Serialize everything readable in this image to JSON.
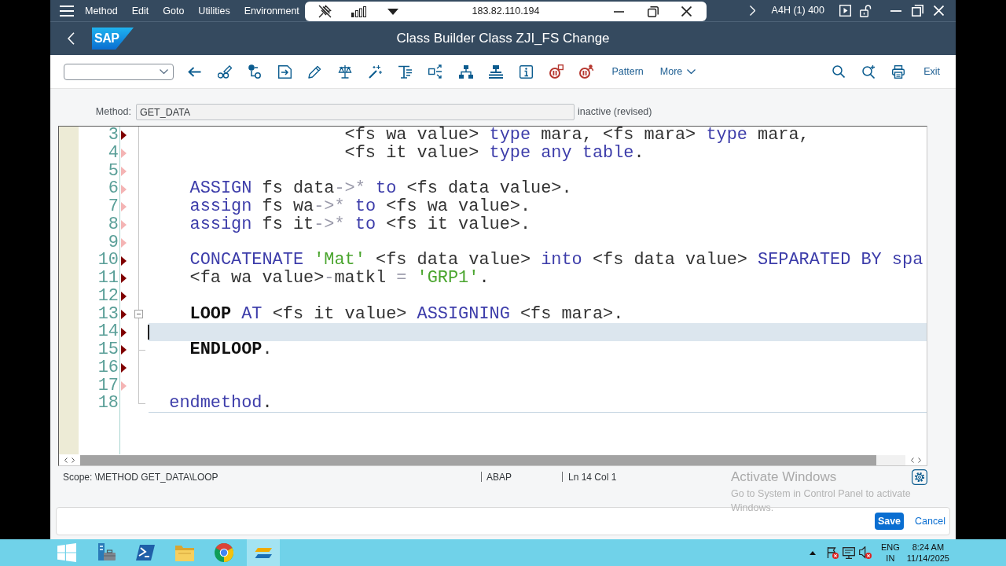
{
  "menu_bar": {
    "menus": [
      "Method",
      "Edit",
      "Goto",
      "Utilities",
      "Environment"
    ],
    "system": "A4H (1) 400"
  },
  "remote_bar": {
    "host": "183.82.110.194"
  },
  "title_bar": {
    "logo": "SAP",
    "title": "Class Builder Class ZJI_FS Change"
  },
  "toolbar": {
    "buttons": [
      {
        "label": "Pattern",
        "kind": "text"
      },
      {
        "label": "More",
        "kind": "menu"
      }
    ],
    "exit": "Exit"
  },
  "method_bar": {
    "label": "Method:",
    "value": "GET_DATA",
    "status": "inactive (revised)"
  },
  "editor": {
    "lines": [
      {
        "number": "3",
        "marker": {
          "color": "#800000"
        },
        "current": false,
        "tokens": [
          {
            "kind": "plain",
            "text": "                   <fs wa value> "
          },
          {
            "kind": "keyword",
            "text": "type"
          },
          {
            "kind": "plain",
            "text": " mara, <fs mara> "
          },
          {
            "kind": "keyword",
            "text": "type"
          },
          {
            "kind": "plain",
            "text": " mara,"
          }
        ]
      },
      {
        "number": "4",
        "marker": {
          "color": "#f4b4b4"
        },
        "current": false,
        "tokens": [
          {
            "kind": "plain",
            "text": "                   <fs it value> "
          },
          {
            "kind": "keyword",
            "text": "type any table"
          },
          {
            "kind": "plain",
            "text": "."
          }
        ]
      },
      {
        "number": "5",
        "marker": {
          "color": "#f4b4b4"
        },
        "current": false
      },
      {
        "number": "6",
        "marker": {
          "color": "#f4b4b4"
        },
        "current": false,
        "tokens": [
          {
            "kind": "keyword",
            "text": "    ASSIGN"
          },
          {
            "kind": "plain",
            "text": " fs data"
          },
          {
            "kind": "operator",
            "text": "->*"
          },
          {
            "kind": "keyword",
            "text": " to"
          },
          {
            "kind": "plain",
            "text": " <fs data value>."
          }
        ]
      },
      {
        "number": "7",
        "marker": {
          "color": "#f4b4b4"
        },
        "current": false,
        "tokens": [
          {
            "kind": "keyword",
            "text": "    assign"
          },
          {
            "kind": "plain",
            "text": " fs wa"
          },
          {
            "kind": "operator",
            "text": "->*"
          },
          {
            "kind": "keyword",
            "text": " to"
          },
          {
            "kind": "plain",
            "text": " <fs wa value>."
          }
        ]
      },
      {
        "number": "8",
        "marker": {
          "color": "#f4b4b4"
        },
        "current": false,
        "tokens": [
          {
            "kind": "keyword",
            "text": "    assign"
          },
          {
            "kind": "plain",
            "text": " fs it"
          },
          {
            "kind": "operator",
            "text": "->*"
          },
          {
            "kind": "keyword",
            "text": " to"
          },
          {
            "kind": "plain",
            "text": " <fs it value>."
          }
        ]
      },
      {
        "number": "9",
        "marker": {
          "color": "#f4b4b4"
        },
        "current": false
      },
      {
        "number": "10",
        "marker": {
          "color": "#800000"
        },
        "current": false,
        "tokens": [
          {
            "kind": "keyword",
            "text": "    CONCATENATE"
          },
          {
            "kind": "string",
            "text": " 'Mat'"
          },
          {
            "kind": "plain",
            "text": " <fs data value> "
          },
          {
            "kind": "keyword",
            "text": "into"
          },
          {
            "kind": "plain",
            "text": " <fs data value> "
          },
          {
            "kind": "keyword",
            "text": "SEPARATED BY spa"
          }
        ]
      },
      {
        "number": "11",
        "marker": {
          "color": "#800000"
        },
        "current": false,
        "tokens": [
          {
            "kind": "plain",
            "text": "    <fa wa value>"
          },
          {
            "kind": "operator",
            "text": "-"
          },
          {
            "kind": "plain",
            "text": "matkl "
          },
          {
            "kind": "operator",
            "text": "="
          },
          {
            "kind": "string",
            "text": " 'GRP1'"
          },
          {
            "kind": "plain",
            "text": "."
          }
        ]
      },
      {
        "number": "12",
        "marker": {
          "color": "#800000"
        },
        "current": false
      },
      {
        "number": "13",
        "marker": {
          "color": "#800000"
        },
        "current": false,
        "expanded": true,
        "tokens": [
          {
            "kind": "control",
            "text": "    LOOP"
          },
          {
            "kind": "keyword",
            "text": " AT"
          },
          {
            "kind": "plain",
            "text": " <fs it value> "
          },
          {
            "kind": "keyword",
            "text": "ASSIGNING"
          },
          {
            "kind": "plain",
            "text": " <fs mara>."
          }
        ]
      },
      {
        "number": "14",
        "marker": {
          "color": "#800000"
        },
        "current": true
      },
      {
        "number": "15",
        "marker": {
          "color": "#800000"
        },
        "current": false,
        "fold_end": true,
        "tokens": [
          {
            "kind": "control",
            "text": "    ENDLOOP"
          },
          {
            "kind": "plain",
            "text": "."
          }
        ]
      },
      {
        "number": "16",
        "marker": {
          "color": "#800000"
        },
        "current": false
      },
      {
        "number": "17",
        "marker": {
          "color": "#f4b4b4"
        },
        "current": false
      },
      {
        "number": "18",
        "current": false,
        "fold_end": true,
        "separator": true,
        "tokens": [
          {
            "kind": "keyword",
            "text": "  endmethod"
          },
          {
            "kind": "plain",
            "text": "."
          }
        ]
      }
    ]
  },
  "status_bar": {
    "scope": "Scope: \\METHOD GET_DATA\\LOOP",
    "language": "ABAP",
    "position": "Ln 14 Col 1"
  },
  "footer": {
    "buttons": [
      {
        "label": "Save",
        "kind": "primary"
      },
      {
        "label": "Cancel",
        "kind": "link"
      }
    ]
  },
  "windows_notice": {
    "title": "Activate Windows",
    "text": "Go to System in Control Panel to activate Windows."
  },
  "taskbar": {
    "apps": [
      {
        "kind": "toolbox",
        "selected": false
      },
      {
        "kind": "terminal",
        "selected": false
      },
      {
        "kind": "folder",
        "selected": false
      },
      {
        "kind": "browser",
        "selected": false
      },
      {
        "kind": "stripes",
        "selected": true
      }
    ],
    "language": "ENG",
    "region": "IN",
    "time": "8:24 AM",
    "date": "11/14/2025"
  }
}
